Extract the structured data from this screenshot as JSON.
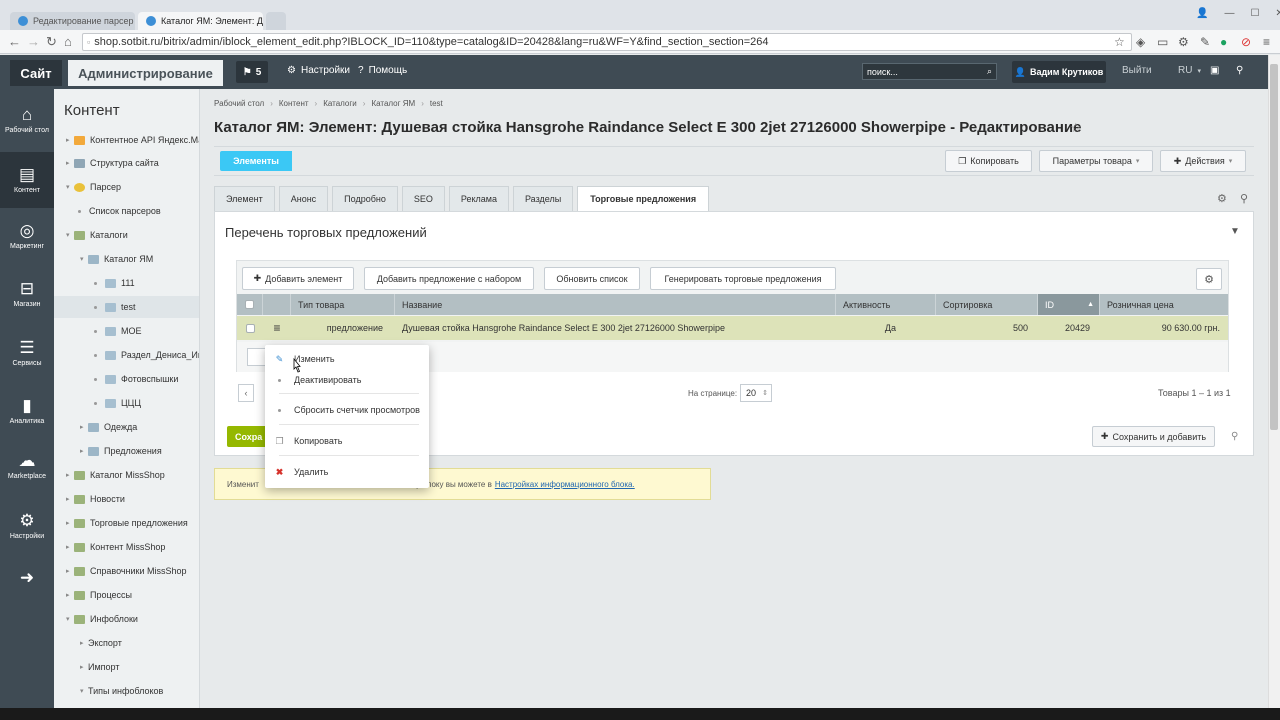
{
  "browser": {
    "tabs": [
      {
        "title": "Редактирование парсер"
      },
      {
        "title": "Каталог ЯМ: Элемент: Д"
      }
    ],
    "url": "shop.sotbit.ru/bitrix/admin/iblock_element_edit.php?IBLOCK_ID=110&type=catalog&ID=20428&lang=ru&WF=Y&find_section_section=264"
  },
  "topbar": {
    "site": "Сайт",
    "admin": "Администрирование",
    "notifications": "5",
    "settings": "Настройки",
    "help": "Помощь",
    "search_placeholder": "поиск...",
    "user": "Вадим Крутиков",
    "logout": "Выйти",
    "lang": "RU"
  },
  "leftnav": [
    {
      "label": "Рабочий стол",
      "icon": "home-icon"
    },
    {
      "label": "Контент",
      "icon": "document-icon"
    },
    {
      "label": "Маркетинг",
      "icon": "target-icon"
    },
    {
      "label": "Магазин",
      "icon": "basket-icon"
    },
    {
      "label": "Сервисы",
      "icon": "layers-icon"
    },
    {
      "label": "Аналитика",
      "icon": "bar-chart-icon"
    },
    {
      "label": "Marketplace",
      "icon": "cloud-download-icon"
    },
    {
      "label": "Настройки",
      "icon": "gear-icon"
    }
  ],
  "tree": {
    "title": "Контент",
    "items": [
      {
        "label": "Контентное API Яндекс.Ма"
      },
      {
        "label": "Структура сайта"
      },
      {
        "label": "Парсер"
      },
      {
        "label": "Список парсеров"
      },
      {
        "label": "Каталоги"
      },
      {
        "label": "Каталог ЯМ"
      },
      {
        "label": "111"
      },
      {
        "label": "test"
      },
      {
        "label": "МОЕ"
      },
      {
        "label": "Раздел_Дениса_Ив"
      },
      {
        "label": "Фотовспышки"
      },
      {
        "label": "ЦЦЦ"
      },
      {
        "label": "Одежда"
      },
      {
        "label": "Предложения"
      },
      {
        "label": "Каталог MissShop"
      },
      {
        "label": "Новости"
      },
      {
        "label": "Торговые предложения"
      },
      {
        "label": "Контент MissShop"
      },
      {
        "label": "Справочники MissShop"
      },
      {
        "label": "Процессы"
      },
      {
        "label": "Инфоблоки"
      },
      {
        "label": "Экспорт"
      },
      {
        "label": "Импорт"
      },
      {
        "label": "Типы инфоблоков"
      }
    ]
  },
  "breadcrumbs": [
    "Рабочий стол",
    "Контент",
    "Каталоги",
    "Каталог ЯМ",
    "test"
  ],
  "page_title": "Каталог ЯМ: Элемент: Душевая стойка Hansgrohe Raindance Select E 300 2jet 27126000 Showerpipe - Редактирование",
  "actions": {
    "elements": "Элементы",
    "copy": "Копировать",
    "params": "Параметры товара",
    "actions": "Действия"
  },
  "form_tabs": [
    "Элемент",
    "Анонс",
    "Подробно",
    "SEO",
    "Реклама",
    "Разделы",
    "Торговые предложения"
  ],
  "offers": {
    "title": "Перечень торговых предложений",
    "buttons": {
      "add": "Добавить элемент",
      "add_set": "Добавить предложение с набором",
      "refresh": "Обновить список",
      "generate": "Генерировать торговые предложения"
    },
    "columns": [
      "Тип товара",
      "Название",
      "Активность",
      "Сортировка",
      "ID",
      "Розничная цена"
    ],
    "rows": [
      {
        "type": "предложение",
        "name": "Душевая стойка Hansgrohe Raindance Select E 300 2jet 27126000 Showerpipe",
        "active": "Да",
        "sort": "500",
        "id": "20429",
        "price": "90 630.00 грн."
      }
    ],
    "per_page_label": "На странице:",
    "per_page": "20",
    "count": "Товары 1 – 1 из 1"
  },
  "save": "Сохра",
  "save_add": "Сохранить и добавить",
  "notice": {
    "left": "Изменит",
    "middle": "онному блоку вы можете в",
    "link": "Настройках информационного блока."
  },
  "context_menu": [
    {
      "label": "Изменить",
      "icon": "edit-icon"
    },
    {
      "label": "Деактивировать",
      "icon": "dot-icon"
    },
    {
      "label": "Сбросить счетчик просмотров",
      "icon": "dot-icon"
    },
    {
      "label": "Копировать",
      "icon": "copy-icon"
    },
    {
      "label": "Удалить",
      "icon": "delete-icon"
    }
  ]
}
